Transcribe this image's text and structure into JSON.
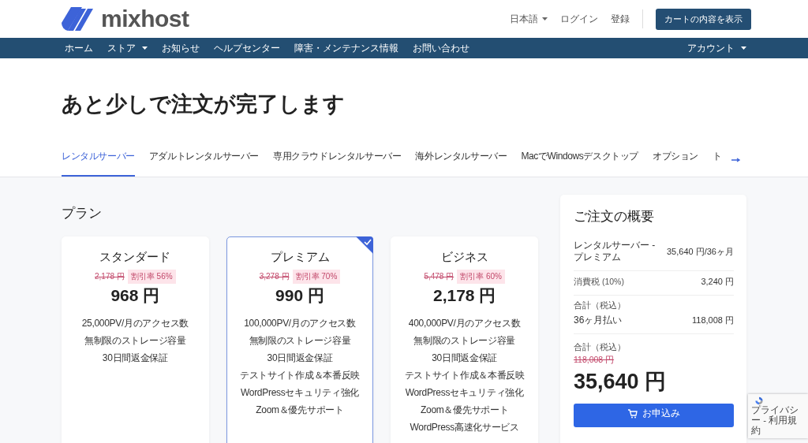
{
  "header": {
    "logo": "mixhost",
    "language": "日本語",
    "login": "ログイン",
    "register": "登録",
    "cart_button": "カートの内容を表示"
  },
  "nav": {
    "items": [
      {
        "label": "ホーム",
        "dropdown": false
      },
      {
        "label": "ストア",
        "dropdown": true
      },
      {
        "label": "お知らせ",
        "dropdown": false
      },
      {
        "label": "ヘルプセンター",
        "dropdown": false
      },
      {
        "label": "障害・メンテナンス情報",
        "dropdown": false
      },
      {
        "label": "お問い合わせ",
        "dropdown": false
      }
    ],
    "account": {
      "label": "アカウント",
      "dropdown": true
    }
  },
  "title": "あと少しで注文が完了します",
  "tabs": [
    {
      "label": "レンタルサーバー",
      "selected": true
    },
    {
      "label": "アダルトレンタルサーバー",
      "selected": false
    },
    {
      "label": "専用クラウドレンタルサーバー",
      "selected": false
    },
    {
      "label": "海外レンタルサーバー",
      "selected": false
    },
    {
      "label": "MacでWindowsデスクトップ",
      "selected": false
    },
    {
      "label": "オプション",
      "selected": false
    },
    {
      "label": "ト",
      "selected": false
    }
  ],
  "plans_heading": "プラン",
  "plans": [
    {
      "name": "スタンダード",
      "original_price": "2,178 円",
      "discount": "割引率 56%",
      "price": "968 円",
      "selected": false,
      "features": [
        "25,000PV/月のアクセス数",
        "無制限のストレージ容量",
        "30日間返金保証"
      ]
    },
    {
      "name": "プレミアム",
      "original_price": "3,278 円",
      "discount": "割引率 70%",
      "price": "990 円",
      "selected": true,
      "features": [
        "100,000PV/月のアクセス数",
        "無制限のストレージ容量",
        "30日間返金保証",
        "テストサイト作成＆本番反映",
        "WordPressセキュリティ強化",
        "Zoom＆優先サポート"
      ]
    },
    {
      "name": "ビジネス",
      "original_price": "5,478 円",
      "discount": "割引率 60%",
      "price": "2,178 円",
      "selected": false,
      "features": [
        "400,000PV/月のアクセス数",
        "無制限のストレージ容量",
        "30日間返金保証",
        "テストサイト作成＆本番反映",
        "WordPressセキュリティ強化",
        "Zoom＆優先サポート",
        "WordPress高速化サービス"
      ]
    }
  ],
  "summary": {
    "title": "ご注文の概要",
    "product": {
      "label": "レンタルサーバー - プレミアム",
      "amount": "35,640 円/36ヶ月"
    },
    "tax": {
      "label": "消費税 (10%)",
      "amount": "3,240 円"
    },
    "subtotal": {
      "caption": "合計（税込）",
      "label": "36ヶ月払い",
      "amount": "118,008 円"
    },
    "total": {
      "caption": "合計（税込）",
      "original": "118,008 円",
      "amount": "35,640 円"
    },
    "order_button": "お申込み"
  },
  "recaptcha": {
    "text": "プライバシー - 利用規約"
  }
}
